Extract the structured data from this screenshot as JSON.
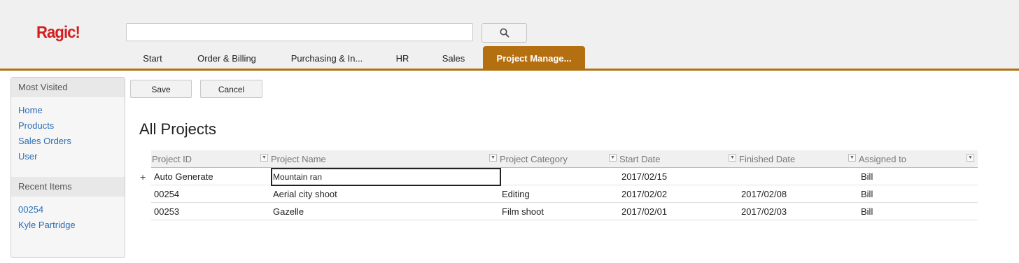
{
  "app": {
    "logo": "Ragic!"
  },
  "search": {
    "value": "",
    "placeholder": ""
  },
  "tabs": [
    {
      "label": "Start"
    },
    {
      "label": "Order & Billing"
    },
    {
      "label": "Purchasing & In..."
    },
    {
      "label": "HR"
    },
    {
      "label": "Sales"
    },
    {
      "label": "Project Manage..."
    }
  ],
  "sidebar": {
    "most_visited_title": "Most Visited",
    "most_visited": [
      {
        "label": "Home"
      },
      {
        "label": "Products"
      },
      {
        "label": "Sales Orders"
      },
      {
        "label": "User"
      }
    ],
    "recent_title": "Recent Items",
    "recent": [
      {
        "label": "00254"
      },
      {
        "label": "Kyle Partridge"
      }
    ]
  },
  "toolbar": {
    "save_label": "Save",
    "cancel_label": "Cancel"
  },
  "page": {
    "title": "All Projects"
  },
  "table": {
    "columns": [
      {
        "label": "Project ID"
      },
      {
        "label": "Project Name"
      },
      {
        "label": "Project Category"
      },
      {
        "label": "Start Date"
      },
      {
        "label": "Finished Date"
      },
      {
        "label": "Assigned to"
      }
    ],
    "new_row": {
      "add_symbol": "+",
      "project_id": "Auto Generate",
      "project_name_input": "Mountain ran",
      "project_category": "",
      "start_date": "2017/02/15",
      "finished_date": "",
      "assigned_to": "Bill"
    },
    "rows": [
      {
        "project_id": "00254",
        "project_name": "Aerial city shoot",
        "project_category": "Editing",
        "start_date": "2017/02/02",
        "finished_date": "2017/02/08",
        "assigned_to": "Bill"
      },
      {
        "project_id": "00253",
        "project_name": "Gazelle",
        "project_category": "Film shoot",
        "start_date": "2017/02/01",
        "finished_date": "2017/02/03",
        "assigned_to": "Bill"
      }
    ]
  },
  "colors": {
    "accent": "#b46f10",
    "logo": "#d11f1f",
    "link": "#2c6fb5"
  }
}
